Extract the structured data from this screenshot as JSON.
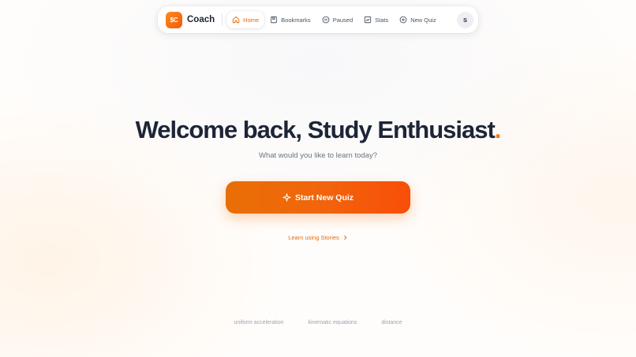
{
  "brand": {
    "logo_text": "$C",
    "name": "Coach",
    "accent_color": "#f07a12"
  },
  "nav": {
    "items": [
      {
        "label": "Home",
        "icon": "home-icon",
        "active": true
      },
      {
        "label": "Bookmarks",
        "icon": "bookmark-icon",
        "active": false
      },
      {
        "label": "Paused",
        "icon": "pause-icon",
        "active": false
      },
      {
        "label": "Stats",
        "icon": "stats-icon",
        "active": false
      },
      {
        "label": "New Quiz",
        "icon": "plus-circle-icon",
        "active": false
      }
    ],
    "avatar_initial": "S"
  },
  "hero": {
    "title": "Welcome back, Study Enthusiast",
    "title_dot": ".",
    "subtitle": "What would you like to learn today?"
  },
  "cta": {
    "label": "Start New Quiz",
    "icon": "sparkle-icon"
  },
  "stories_link": {
    "label": "Learn using Stories",
    "icon": "chevron-right-icon"
  },
  "topics": [
    "uniform acceleration",
    "kinematic equations",
    "distance"
  ]
}
